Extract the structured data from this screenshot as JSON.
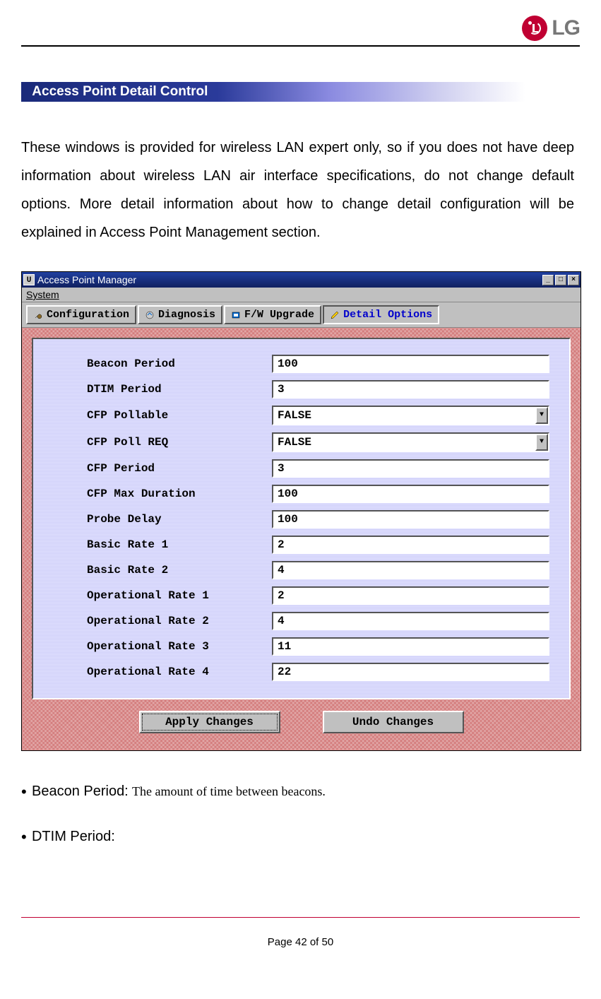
{
  "brand": "LG",
  "section_title": "Access Point Detail Control",
  "intro_paragraph": "These windows is provided for wireless LAN expert only, so if you does not have deep information about wireless LAN air interface specifications, do not change default options. More detail information about how to change detail configuration will be explained in Access Point Management section.",
  "window": {
    "title": "Access Point Manager",
    "icon_letter": "U",
    "menu": {
      "system": "System"
    },
    "win_buttons": {
      "min": "_",
      "max": "□",
      "close": "×"
    },
    "tabs": {
      "configuration": "Configuration",
      "diagnosis": "Diagnosis",
      "fw_upgrade": "F/W Upgrade",
      "detail_options": "Detail Options"
    },
    "fields": {
      "beacon_period": {
        "label": "Beacon Period",
        "value": "100",
        "type": "text"
      },
      "dtim_period": {
        "label": "DTIM Period",
        "value": "3",
        "type": "text"
      },
      "cfp_pollable": {
        "label": "CFP Pollable",
        "value": "FALSE",
        "type": "select"
      },
      "cfp_poll_req": {
        "label": "CFP Poll REQ",
        "value": "FALSE",
        "type": "select"
      },
      "cfp_period": {
        "label": "CFP Period",
        "value": "3",
        "type": "text"
      },
      "cfp_max_duration": {
        "label": "CFP Max Duration",
        "value": "100",
        "type": "text"
      },
      "probe_delay": {
        "label": "Probe Delay",
        "value": "100",
        "type": "text"
      },
      "basic_rate_1": {
        "label": "Basic Rate 1",
        "value": "2",
        "type": "text"
      },
      "basic_rate_2": {
        "label": "Basic Rate 2",
        "value": "4",
        "type": "text"
      },
      "operational_rate_1": {
        "label": "Operational Rate 1",
        "value": "2",
        "type": "text"
      },
      "operational_rate_2": {
        "label": "Operational Rate 2",
        "value": "4",
        "type": "text"
      },
      "operational_rate_3": {
        "label": "Operational Rate 3",
        "value": "11",
        "type": "text"
      },
      "operational_rate_4": {
        "label": "Operational Rate 4",
        "value": "22",
        "type": "text"
      }
    },
    "buttons": {
      "apply": "Apply Changes",
      "undo": "Undo Changes"
    }
  },
  "bullets": {
    "beacon": {
      "label": "Beacon Period:",
      "desc": " The amount of time between beacons."
    },
    "dtim": {
      "label": "DTIM Period:",
      "desc": ""
    }
  },
  "footer": "Page 42 of 50"
}
